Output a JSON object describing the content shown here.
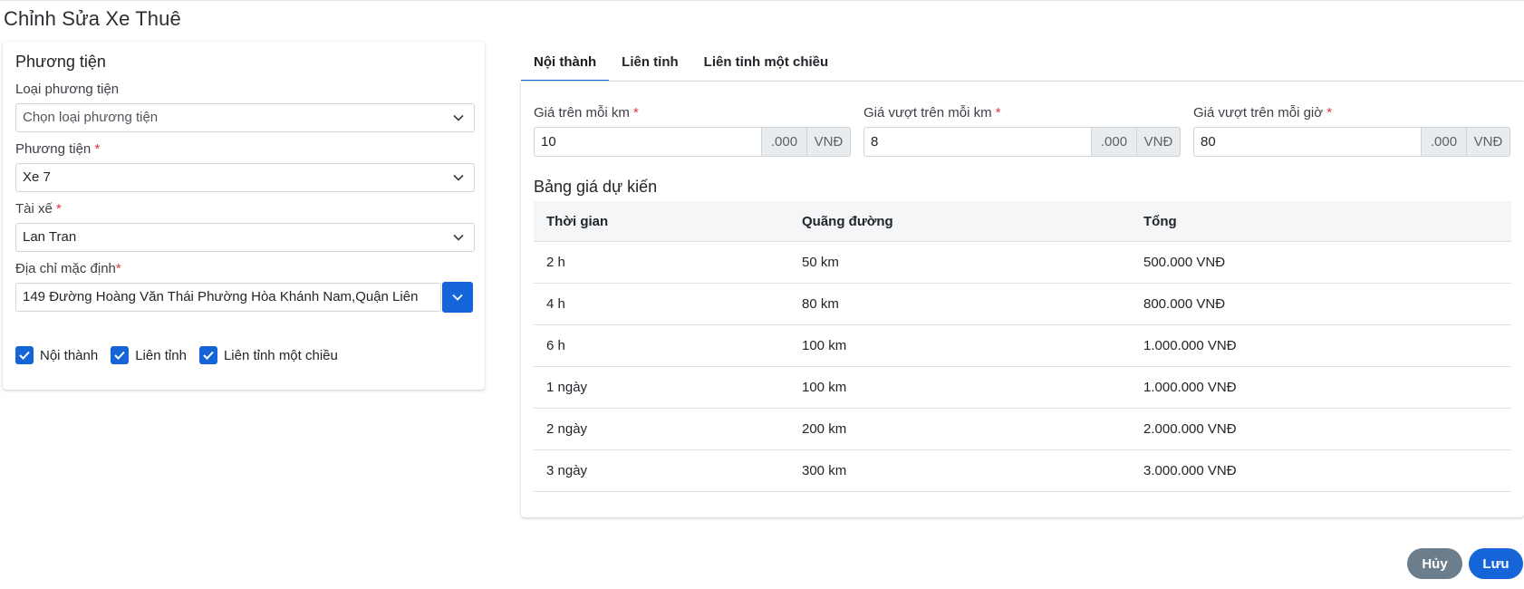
{
  "page": {
    "title": "Chỉnh Sửa Xe Thuê"
  },
  "vehicle_card": {
    "title": "Phương tiện",
    "vehicle_type": {
      "label": "Loại phương tiện",
      "value": "Chọn loại phương tiện"
    },
    "vehicle": {
      "label": "Phương tiện",
      "value": "Xe 7"
    },
    "driver": {
      "label": "Tài xế",
      "value": "Lan Tran"
    },
    "address": {
      "label": "Địa chỉ mặc định",
      "value": "149 Đường Hoàng Văn Thái Phường Hòa Khánh Nam,Quận Liên"
    },
    "required_mark": "*",
    "checkboxes": [
      {
        "label": "Nội thành",
        "checked": true
      },
      {
        "label": "Liên tỉnh",
        "checked": true
      },
      {
        "label": "Liên tỉnh một chiều",
        "checked": true
      }
    ]
  },
  "tabs": [
    {
      "label": "Nội thành",
      "active": true
    },
    {
      "label": "Liên tỉnh",
      "active": false
    },
    {
      "label": "Liên tỉnh một chiều",
      "active": false
    }
  ],
  "pricing": {
    "fields": [
      {
        "label": "Giá trên mỗi km",
        "value": "10",
        "suffix": ".000",
        "currency": "VNĐ"
      },
      {
        "label": "Giá vượt trên mỗi km",
        "value": "8",
        "suffix": ".000",
        "currency": "VNĐ"
      },
      {
        "label": "Giá vượt trên mỗi giờ",
        "value": "80",
        "suffix": ".000",
        "currency": "VNĐ"
      }
    ]
  },
  "estimate_table": {
    "title": "Bảng giá dự kiến",
    "columns": [
      "Thời gian",
      "Quãng đường",
      "Tổng"
    ],
    "rows": [
      [
        "2 h",
        "50 km",
        "500.000 VNĐ"
      ],
      [
        "4 h",
        "80 km",
        "800.000 VNĐ"
      ],
      [
        "6 h",
        "100 km",
        "1.000.000 VNĐ"
      ],
      [
        "1 ngày",
        "100 km",
        "1.000.000 VNĐ"
      ],
      [
        "2 ngày",
        "200 km",
        "2.000.000 VNĐ"
      ],
      [
        "3 ngày",
        "300 km",
        "3.000.000 VNĐ"
      ]
    ]
  },
  "actions": {
    "cancel": "Hủy",
    "save": "Lưu"
  },
  "colors": {
    "primary": "#1565d8",
    "secondary": "#6c7d8c",
    "required": "#dc3545"
  }
}
